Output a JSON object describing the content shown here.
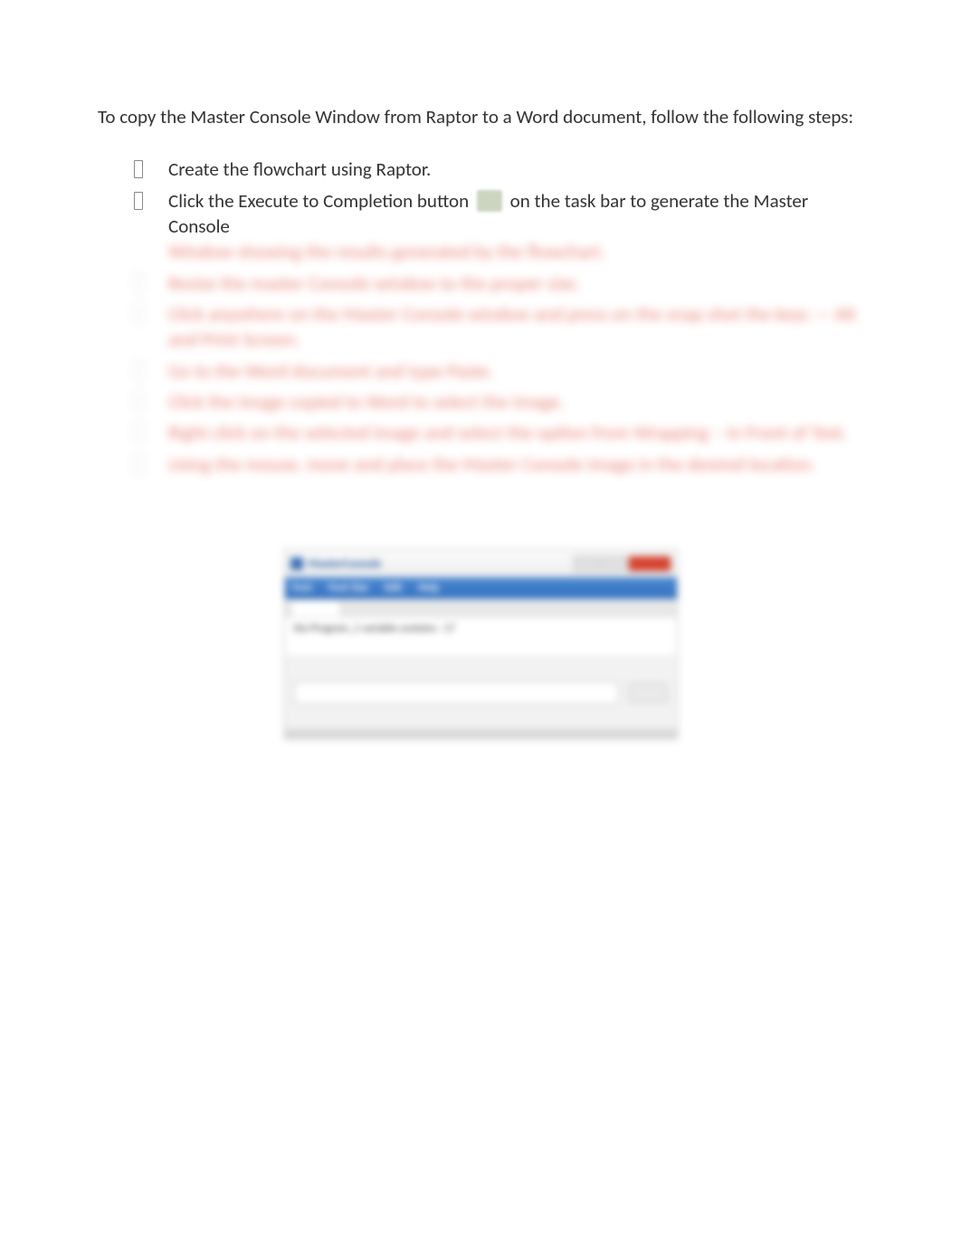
{
  "intro": "To copy the Master Console Window from Raptor to a Word document, follow the following steps:",
  "steps": {
    "item1": "Create the flowchart using Raptor.",
    "item2a": "Click the Execute to Completion button",
    "item2b": "on the task bar to generate the Master Console",
    "item2_cont_blurred": "Window showing the results generated by the flowchart.",
    "blurred_3": "Resize the master Console window to the proper size.",
    "blurred_4": "Click anywhere on the Master Console window and press on the snap shot the keys — Alt and Print Screen.",
    "blurred_5": "Go to the Word document and type Paste.",
    "blurred_6": "Click the image copied to Word to select the image.",
    "blurred_7": "Right click on the selected image and select the option from Wrapping – In Front of Text.",
    "blurred_8": "Using the mouse, move and place the Master Console image in the desired location."
  },
  "screenshot": {
    "title": "MasterConsole",
    "menu": {
      "m1": "Font",
      "m2": "Font Size",
      "m3": "Edit",
      "m4": "Help"
    },
    "content_line": "the Program_1 variable contains : 17"
  }
}
